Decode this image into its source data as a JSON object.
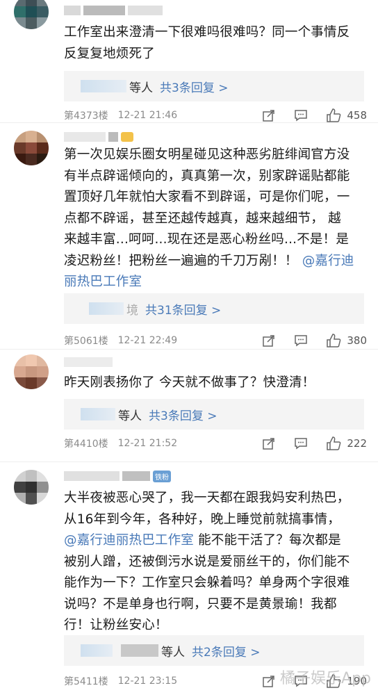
{
  "comments": [
    {
      "text_lines": [
        "工作室出来澄清一下很难吗很难吗？同一个事情反",
        "反复复地烦死了"
      ],
      "reply_prefix": "等人",
      "reply_link": "共3条回复 >",
      "floor": "第4373楼",
      "time": "12-21 21:46",
      "likes": "458"
    },
    {
      "text_lines": [
        "第一次见娱乐圈女明星碰见这种恶劣脏绯闻官方没",
        "有半点辟谣倾向的，真真第一次，别家辟谣贴都能",
        "置顶好几年就怕大家看不到辟谣，可是你们呢，一",
        "点都不辟谣，甚至还越传越真，越来越细节， 越",
        "来越丰富...呵呵...现在还是恶心粉丝吗...不是！是",
        "凌迟粉丝！把粉丝一遍遍的千刀万剐！！"
      ],
      "mention_tail": "@嘉行迪",
      "mention_line": "丽热巴工作室",
      "reply_prefix": "境",
      "reply_link": "共31条回复 >",
      "floor": "第5061楼",
      "time": "12-21 22:49",
      "likes": "380"
    },
    {
      "text_lines": [
        "昨天刚表扬你了 今天就不做事了？快澄清！"
      ],
      "reply_prefix": "等人",
      "reply_link": "共3条回复 >",
      "floor": "第4410楼",
      "time": "12-21 21:52",
      "likes": "222"
    },
    {
      "badge": "铁粉",
      "text_lines": [
        "大半夜被恶心哭了，我一天都在跟我妈安利热巴，",
        "从16年到今年，各种好，晚上睡觉前就搞事情，"
      ],
      "mention": "@嘉行迪丽热巴工作室",
      "mention_rest": " 能不能干活了？每次都是",
      "text_lines2": [
        "被别人蹭，还被倒污水说是爱丽丝干的，你们能不",
        "能作为一下？工作室只会躲着吗？单身两个字很难",
        "说吗？不是单身也行啊，只要不是黄景瑜！我都",
        "行！让粉丝安心！"
      ],
      "reply_prefix": "等人",
      "reply_link": "共2条回复 >",
      "floor": "第5411楼",
      "time": "12-21 23:15",
      "likes": "190"
    }
  ],
  "watermark": "橘子娱乐App"
}
